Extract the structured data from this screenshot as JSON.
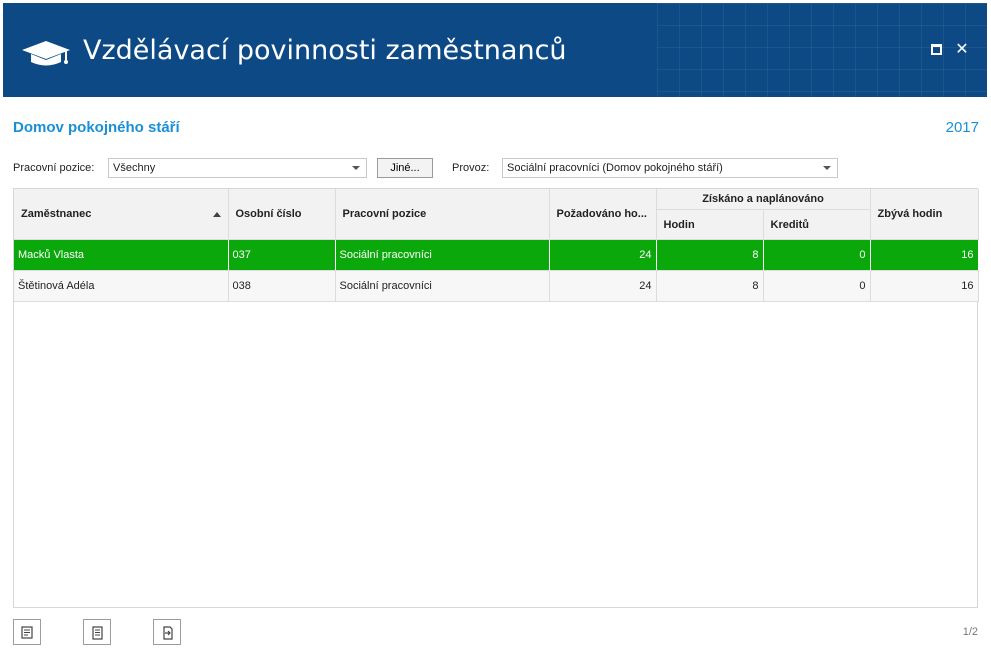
{
  "window": {
    "title": "Vzdělávací povinnosti zaměstnanců",
    "logo_icon": "graduation-cap-icon",
    "maximize_icon": "maximize-icon",
    "close_icon": "close-icon",
    "close_glyph": "✕"
  },
  "header": {
    "organization": "Domov pokojného stáří",
    "year": "2017"
  },
  "filters": {
    "position_label": "Pracovní pozice:",
    "position_value": "Všechny",
    "other_button": "Jiné...",
    "operation_label": "Provoz:",
    "operation_value": "Sociální pracovníci (Domov pokojného stáří)"
  },
  "table": {
    "columns": {
      "employee": "Zaměstnanec",
      "personal_number": "Osobní číslo",
      "position": "Pracovní pozice",
      "required_hours": "Požadováno ho...",
      "obtained_group": "Získáno a naplánováno",
      "hours": "Hodin",
      "credits": "Kreditů",
      "remaining_hours": "Zbývá hodin"
    },
    "rows": [
      {
        "employee": "Macků Vlasta",
        "personal_number": "037",
        "position": "Sociální pracovníci",
        "required_hours": "24",
        "hours": "8",
        "credits": "0",
        "remaining_hours": "16",
        "selected": true
      },
      {
        "employee": "Štětinová Adéla",
        "personal_number": "038",
        "position": "Sociální pracovníci",
        "required_hours": "24",
        "hours": "8",
        "credits": "0",
        "remaining_hours": "16",
        "selected": false
      }
    ]
  },
  "toolbar": {
    "buttons": [
      "edit-icon",
      "document-icon",
      "export-icon"
    ]
  },
  "pager": {
    "text": "1/2"
  },
  "colors": {
    "titlebar": "#0d4a85",
    "accent": "#1a8fd8",
    "selected_row": "#0ba80b"
  }
}
